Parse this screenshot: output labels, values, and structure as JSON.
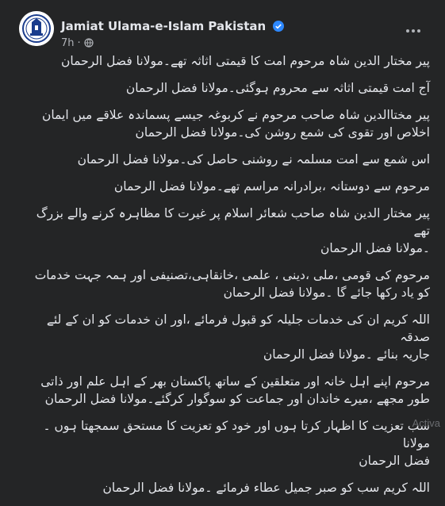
{
  "post": {
    "page_name": "Jamiat Ulama-e-Islam Pakistan",
    "time": "7h",
    "dot": "·",
    "paragraphs": [
      "پیر مختار الدین شاہ مرحوم امت کا قیمتی اثاثہ تھے۔مولانا فضل الرحمان",
      "آج امت قیمتی اثاثہ سے محروم ہوگئی۔مولانا فضل الرحمان",
      "پیر مختاالدین شاہ صاحب مرحوم نے کربوغہ جیسے پسماندہ علاقے میں ایمان\nاخلاص اور تقوی کی شمع روشن کی۔مولانا فضل الرحمان",
      "اس شمع سے امت مسلمہ نے روشنی حاصل کی۔مولانا فضل الرحمان",
      "مرحوم سے دوستانہ ،برادرانہ مراسم تھے۔مولانا فضل الرحمان",
      "پیر مختار الدین شاہ صاحب شعائر اسلام پر غیرت کا مظاہرہ کرنے والے بزرگ تھے\n۔مولانا فضل الرحمان",
      "مرحوم کی قومی ،ملی ،دینی ، علمی ،خانقاہی،تصنیفی اور ہمہ جہت خدمات\nکو یاد رکھا جائے گا ۔مولانا فضل الرحمان",
      "اللہ کریم ان کی خدمات جلیلہ کو قبول فرمائے ،اور ان خدمات کو ان کے لئے صدقہ\nجاریہ بنائے ۔مولانا فضل الرحمان",
      "مرحوم اپنے  اہل خانہ اور متعلقین کے ساتھ پاکستان بھر کے اہل علم اور ذاتی\nطور مجھے ،میرے خاندان اور جماعت کو سوگوار کرگئے۔مولانا فضل الرحمان",
      "سب تعزیت کا اظہار کرتا ہوں اور خود کو تعزیت کا مستحق سمجھتا ہوں ۔مولانا\nفضل الرحمان",
      "اللہ کریم سب کو صبر جمیل عطاء فرمائے ۔مولانا فضل الرحمان"
    ]
  },
  "watermark": "Activa",
  "colors": {
    "background": "#242526",
    "text": "#e4e6eb",
    "secondary": "#b0b3b8",
    "verified": "#2d88ff"
  }
}
